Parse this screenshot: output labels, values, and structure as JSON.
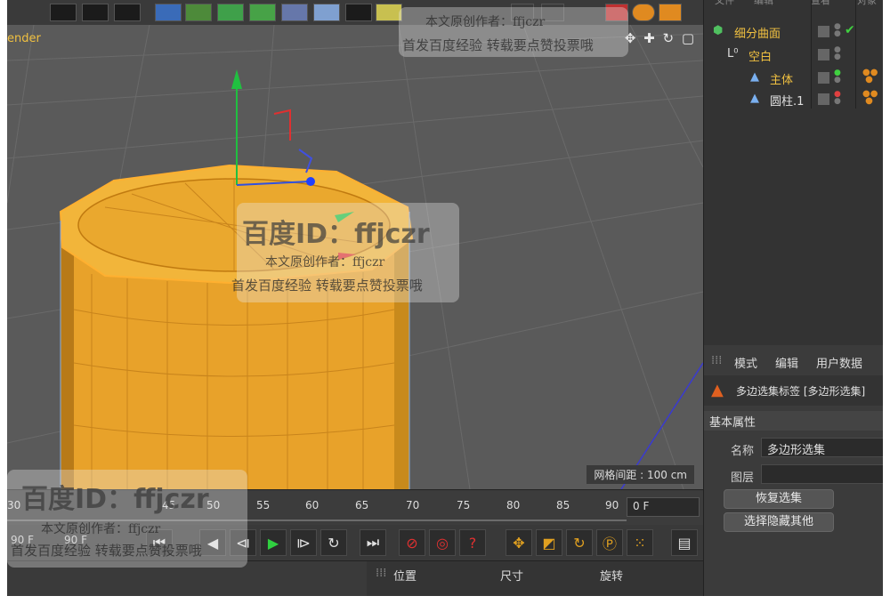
{
  "viewport": {
    "label": "ender",
    "nav_icons": "✥ ✚ ↻ ▢",
    "grid_readout": "网格间距 : 100 cm"
  },
  "timeline": {
    "ticks": [
      "30",
      "45",
      "50",
      "55",
      "60",
      "65",
      "70",
      "75",
      "80",
      "85",
      "90"
    ],
    "current_frame": "0 F",
    "start_left": "90 F",
    "start_right": "90 F"
  },
  "object_manager": {
    "header": [
      "文件",
      "编辑",
      "查看",
      "对象"
    ],
    "items": [
      {
        "name": "细分曲面",
        "color": "#f0c040"
      },
      {
        "name": "空白",
        "color": "#f0c040"
      },
      {
        "name": "主体",
        "color": "#f0c040"
      },
      {
        "name": "圆柱.1",
        "color": "#e0e0e0"
      }
    ]
  },
  "attributes": {
    "tabs": [
      "模式",
      "编辑",
      "用户数据"
    ],
    "title": "多边选集标签 [多边形选集]",
    "section": "基本属性",
    "name_label": "名称",
    "name_value": "多边形选集",
    "layer_label": "图层",
    "restore_button": "恢复选集",
    "hide_others_button": "选择隐藏其他"
  },
  "coords": {
    "position": "位置",
    "size": "尺寸",
    "rotation": "旋转"
  },
  "watermarks": {
    "id_text": "百度ID：ffjczr",
    "author": "本文原创作者：ffjczr",
    "notice": "首发百度经验 转载要点赞投票哦",
    "author_top": "本文原创作者：ffjczr"
  }
}
